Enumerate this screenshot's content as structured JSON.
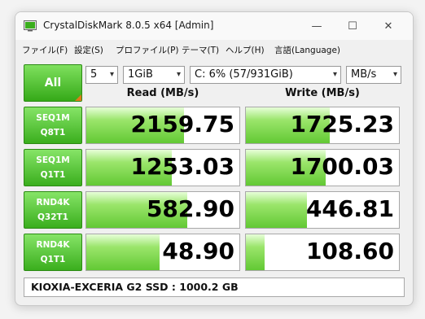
{
  "window": {
    "title": "CrystalDiskMark 8.0.5 x64 [Admin]"
  },
  "window_controls": {
    "minimize": "—",
    "maximize": "☐",
    "close": "✕"
  },
  "menu": [
    "ファイル(F)",
    "設定(S)",
    "プロファイル(P)",
    "テーマ(T)",
    "ヘルプ(H)",
    "言語(Language)"
  ],
  "toolbar": {
    "all_label": "All",
    "count": "5",
    "size": "1GiB",
    "drive": "C: 6% (57/931GiB)",
    "unit": "MB/s"
  },
  "headers": {
    "read": "Read (MB/s)",
    "write": "Write (MB/s)"
  },
  "rows": [
    {
      "line1": "SEQ1M",
      "line2": "Q8T1",
      "read": "2159.75",
      "write": "1725.23",
      "read_fraction": 0.64,
      "write_fraction": 0.55
    },
    {
      "line1": "SEQ1M",
      "line2": "Q1T1",
      "read": "1253.03",
      "write": "1700.03",
      "read_fraction": 0.56,
      "write_fraction": 0.52
    },
    {
      "line1": "RND4K",
      "line2": "Q32T1",
      "read": "582.90",
      "write": "446.81",
      "read_fraction": 0.66,
      "write_fraction": 0.4
    },
    {
      "line1": "RND4K",
      "line2": "Q1T1",
      "read": "48.90",
      "write": "108.60",
      "read_fraction": 0.48,
      "write_fraction": 0.12
    }
  ],
  "footer": {
    "text": "KIOXIA-EXCERIA G2 SSD : 1000.2 GB"
  },
  "colors": {
    "accent_green": "#3aae1d",
    "bar_green": "#62c934",
    "corner_orange": "#e07a1a"
  }
}
